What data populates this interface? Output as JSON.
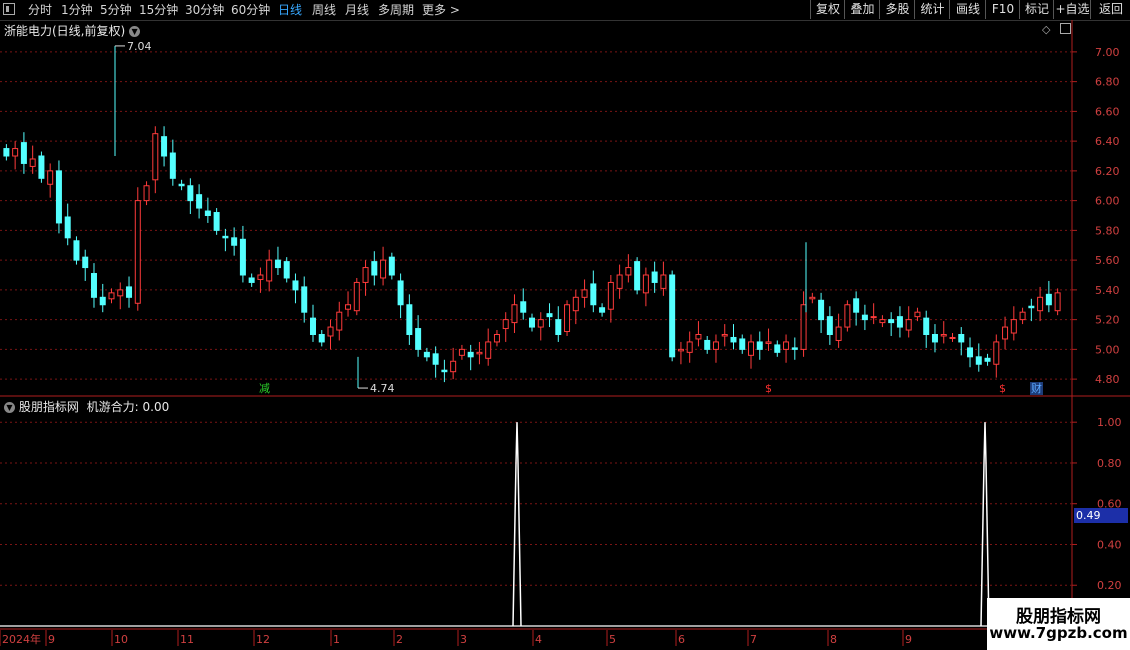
{
  "toolbar": {
    "periods": [
      "分时",
      "1分钟",
      "5分钟",
      "15分钟",
      "30分钟",
      "60分钟",
      "日线",
      "周线",
      "月线",
      "多周期",
      "更多 >"
    ],
    "active_period": "日线",
    "right_buttons": [
      "复权",
      "叠加",
      "多股",
      "统计",
      "画线",
      "F10",
      "标记",
      "+自选",
      "返回"
    ]
  },
  "main_panel": {
    "title": "浙能电力(日线,前复权)",
    "max_label": "7.04",
    "min_label": "4.74",
    "y_ticks": [
      "7.00",
      "6.80",
      "6.60",
      "6.40",
      "6.20",
      "6.00",
      "5.80",
      "5.60",
      "5.40",
      "5.20",
      "5.00",
      "4.80"
    ],
    "markers": [
      {
        "text": "减",
        "color": "#2ad12a"
      },
      {
        "text": "$",
        "color": "#ff3030"
      },
      {
        "text": "$",
        "color": "#ff3030"
      },
      {
        "text": "财",
        "color": "#5aa8ff"
      }
    ]
  },
  "indicator_panel": {
    "title": "股朋指标网",
    "label": "机游合力:",
    "value": "0.00",
    "y_ticks": [
      "1.00",
      "0.80",
      "0.60",
      "0.40",
      "0.20"
    ],
    "current_value_tag": "0.49"
  },
  "x_axis": {
    "labels": [
      "2024年",
      "9",
      "10",
      "11",
      "12",
      "1",
      "2",
      "3",
      "4",
      "5",
      "6",
      "7",
      "8",
      "9"
    ]
  },
  "watermark": {
    "line1": "股朋指标网",
    "line2": "www.7gpzb.com"
  },
  "colors": {
    "up": "#ff3b3b",
    "down": "#54ffff",
    "grid": "#7a1414",
    "axis": "#b01e1e",
    "active": "#37a8ff"
  },
  "chart_data": {
    "type": "candlestick",
    "title": "浙能电力(日线,前复权)",
    "y_range": [
      4.7,
      7.1
    ],
    "high_marked": 7.04,
    "low_marked": 4.74,
    "close_series": [
      6.3,
      6.35,
      6.25,
      6.28,
      6.15,
      6.2,
      5.85,
      5.75,
      5.6,
      5.55,
      5.35,
      5.3,
      5.38,
      5.4,
      5.35,
      6.0,
      6.1,
      6.45,
      6.3,
      6.15,
      6.1,
      6.0,
      5.95,
      5.9,
      5.8,
      5.75,
      5.7,
      5.5,
      5.45,
      5.5,
      5.6,
      5.55,
      5.48,
      5.4,
      5.25,
      5.1,
      5.05,
      5.15,
      5.25,
      5.3,
      5.45,
      5.55,
      5.5,
      5.6,
      5.5,
      5.3,
      5.1,
      5.0,
      4.95,
      4.9,
      4.85,
      4.92,
      5.0,
      4.95,
      4.98,
      5.05,
      5.1,
      5.2,
      5.3,
      5.25,
      5.15,
      5.2,
      5.22,
      5.1,
      5.3,
      5.35,
      5.4,
      5.3,
      5.25,
      5.45,
      5.5,
      5.55,
      5.4,
      5.5,
      5.45,
      5.5,
      4.95,
      5.0,
      5.05,
      5.1,
      5.0,
      5.05,
      5.1,
      5.05,
      5.0,
      5.05,
      5.0,
      5.05,
      4.98,
      5.05,
      5.0,
      5.3,
      5.35,
      5.2,
      5.1,
      5.15,
      5.3,
      5.25,
      5.2,
      5.22,
      5.2,
      5.18,
      5.15,
      5.2,
      5.25,
      5.1,
      5.05,
      5.1,
      5.08,
      5.05,
      4.95,
      4.9,
      4.92,
      5.05,
      5.15,
      5.2,
      5.25,
      5.28,
      5.35,
      5.3,
      5.38
    ],
    "indicator": {
      "name": "机游合力",
      "spikes_at_month": [
        "4",
        "9"
      ],
      "values": [
        0,
        1,
        0,
        1,
        0
      ],
      "ylim": [
        0,
        1.05
      ]
    }
  }
}
